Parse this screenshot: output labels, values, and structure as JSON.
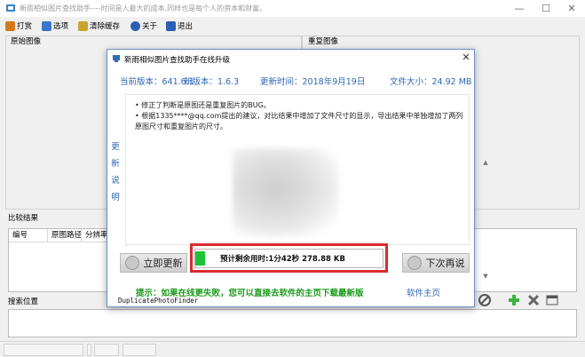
{
  "main_window": {
    "title": "新雨相似图片查找助手----时间是人最大的成本,同样也是每个人的资本和财富。",
    "menu": [
      {
        "label": "打赏",
        "icon": "gift-icon",
        "color": "#d47a1e"
      },
      {
        "label": "选项",
        "icon": "options-icon",
        "color": "#3a78c9"
      },
      {
        "label": "清除缓存",
        "icon": "broom-icon",
        "color": "#c9a431"
      },
      {
        "label": "关于",
        "icon": "info-icon",
        "color": "#2c5fb3"
      },
      {
        "label": "退出",
        "icon": "exit-icon",
        "color": "#2c5fb3"
      }
    ],
    "original_image_label": "原始图像",
    "duplicate_image_label": "重复图像",
    "compare_result_label": "比较结果",
    "table_columns": [
      "编号",
      "原图路径",
      "分辨率"
    ],
    "search_location_label": "搜索位置"
  },
  "dialog": {
    "title": "新雨相似图片查找助手在线升级",
    "current_version_label": "当前版本：",
    "current_version": "641.6.1",
    "new_version_label": "新版本：",
    "new_version": "1.6.3",
    "update_time_label": "更新时间：",
    "update_time": "2018年9月19日",
    "file_size_label": "文件大小：",
    "file_size": "24.92 MB",
    "changelog_side_label": [
      "更",
      "新",
      "说",
      "明"
    ],
    "changelog": [
      "修正了判断是原图还是重复图片的BUG。",
      "根据1335****@qq.com提出的建议，对比结果中增加了文件尺寸的显示，导出结果中单独增加了两列原图尺寸和重复图片的尺寸。"
    ],
    "update_now_button": "立即更新",
    "later_button": "下次再说",
    "progress_text": "预计剩余用时:1分42秒    278.88 KB",
    "progress_fraction": 0.05,
    "tip": "提示：如果在线更失败，您可以直接去软件的主页下载最新版",
    "homepage_link": "软件主页",
    "footer_name": "DuplicatePhotoFinder",
    "highlight_color": "#d92c2c",
    "progress_color": "#1ec237"
  }
}
